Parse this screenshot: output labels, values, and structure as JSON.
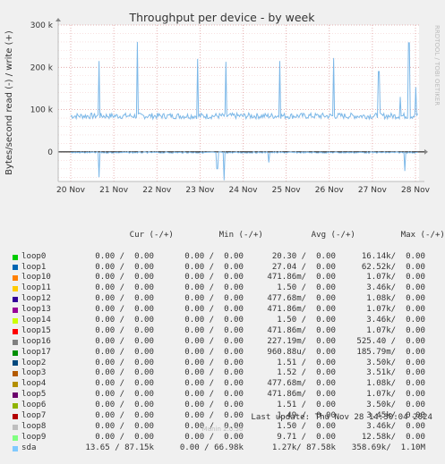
{
  "chart_data": {
    "type": "line",
    "title": "Throughput per device - by week",
    "ylabel": "Bytes/second read (-) / write (+)",
    "ylim": [
      -70000,
      300000
    ],
    "yticks": [
      {
        "value": 300000,
        "label": "300 k"
      },
      {
        "value": 200000,
        "label": "200 k"
      },
      {
        "value": 100000,
        "label": "100 k"
      },
      {
        "value": 0,
        "label": "0"
      }
    ],
    "xticks": [
      "20 Nov",
      "21 Nov",
      "22 Nov",
      "23 Nov",
      "24 Nov",
      "25 Nov",
      "26 Nov",
      "27 Nov",
      "28 Nov"
    ],
    "grid": true,
    "series": [
      {
        "name": "sda",
        "color": "#7cb8e8",
        "write_approx": {
          "baseline": 85000,
          "spikes": [
            {
              "day": 0.65,
              "value": 215000
            },
            {
              "day": 1.55,
              "value": 260000
            },
            {
              "day": 2.95,
              "value": 220000
            },
            {
              "day": 3.6,
              "value": 213000
            },
            {
              "day": 4.85,
              "value": 215000
            },
            {
              "day": 6.1,
              "value": 222000
            },
            {
              "day": 7.15,
              "value": 190000
            },
            {
              "day": 7.65,
              "value": 130000
            },
            {
              "day": 7.85,
              "value": 258000
            },
            {
              "day": 8.0,
              "value": 153000
            }
          ]
        },
        "read_approx": {
          "baseline": 0,
          "spikes": [
            {
              "day": 0.65,
              "value": -60000
            },
            {
              "day": 3.4,
              "value": -40000
            },
            {
              "day": 3.55,
              "value": -66980
            },
            {
              "day": 4.6,
              "value": -25000
            },
            {
              "day": 7.75,
              "value": -45000
            }
          ]
        }
      }
    ]
  },
  "legend": {
    "headers": {
      "cur": "Cur (-/+)",
      "min": "Min (-/+)",
      "avg": "Avg (-/+)",
      "max": "Max (-/+)"
    },
    "rows": [
      {
        "name": "loop0",
        "color": "#00cc00",
        "cur": "0.00 /  0.00",
        "min": "0.00 /  0.00",
        "avg": "20.30 /  0.00",
        "max": "16.14k/  0.00"
      },
      {
        "name": "loop1",
        "color": "#0066b3",
        "cur": "0.00 /  0.00",
        "min": "0.00 /  0.00",
        "avg": "27.04 /  0.00",
        "max": "62.52k/  0.00"
      },
      {
        "name": "loop10",
        "color": "#ff8000",
        "cur": "0.00 /  0.00",
        "min": "0.00 /  0.00",
        "avg": "471.86m/  0.00",
        "max": "1.07k/  0.00"
      },
      {
        "name": "loop11",
        "color": "#ffcc00",
        "cur": "0.00 /  0.00",
        "min": "0.00 /  0.00",
        "avg": "1.50 /  0.00",
        "max": "3.46k/  0.00"
      },
      {
        "name": "loop12",
        "color": "#330099",
        "cur": "0.00 /  0.00",
        "min": "0.00 /  0.00",
        "avg": "477.68m/  0.00",
        "max": "1.08k/  0.00"
      },
      {
        "name": "loop13",
        "color": "#990099",
        "cur": "0.00 /  0.00",
        "min": "0.00 /  0.00",
        "avg": "471.86m/  0.00",
        "max": "1.07k/  0.00"
      },
      {
        "name": "loop14",
        "color": "#ccff00",
        "cur": "0.00 /  0.00",
        "min": "0.00 /  0.00",
        "avg": "1.50 /  0.00",
        "max": "3.46k/  0.00"
      },
      {
        "name": "loop15",
        "color": "#ff0000",
        "cur": "0.00 /  0.00",
        "min": "0.00 /  0.00",
        "avg": "471.86m/  0.00",
        "max": "1.07k/  0.00"
      },
      {
        "name": "loop16",
        "color": "#808080",
        "cur": "0.00 /  0.00",
        "min": "0.00 /  0.00",
        "avg": "227.19m/  0.00",
        "max": "525.40 /  0.00"
      },
      {
        "name": "loop17",
        "color": "#008f00",
        "cur": "0.00 /  0.00",
        "min": "0.00 /  0.00",
        "avg": "960.88u/  0.00",
        "max": "185.79m/  0.00"
      },
      {
        "name": "loop2",
        "color": "#00487d",
        "cur": "0.00 /  0.00",
        "min": "0.00 /  0.00",
        "avg": "1.51 /  0.00",
        "max": "3.50k/  0.00"
      },
      {
        "name": "loop3",
        "color": "#b35a00",
        "cur": "0.00 /  0.00",
        "min": "0.00 /  0.00",
        "avg": "1.52 /  0.00",
        "max": "3.51k/  0.00"
      },
      {
        "name": "loop4",
        "color": "#b38f00",
        "cur": "0.00 /  0.00",
        "min": "0.00 /  0.00",
        "avg": "477.68m/  0.00",
        "max": "1.08k/  0.00"
      },
      {
        "name": "loop5",
        "color": "#6b006b",
        "cur": "0.00 /  0.00",
        "min": "0.00 /  0.00",
        "avg": "471.86m/  0.00",
        "max": "1.07k/  0.00"
      },
      {
        "name": "loop6",
        "color": "#8fb300",
        "cur": "0.00 /  0.00",
        "min": "0.00 /  0.00",
        "avg": "1.51 /  0.00",
        "max": "3.50k/  0.00"
      },
      {
        "name": "loop7",
        "color": "#b30000",
        "cur": "0.00 /  0.00",
        "min": "0.00 /  0.00",
        "avg": "1.49 /  0.00",
        "max": "3.45k/  0.00"
      },
      {
        "name": "loop8",
        "color": "#bebebe",
        "cur": "0.00 /  0.00",
        "min": "0.00 /  0.00",
        "avg": "1.50 /  0.00",
        "max": "3.46k/  0.00"
      },
      {
        "name": "loop9",
        "color": "#80ff80",
        "cur": "0.00 /  0.00",
        "min": "0.00 /  0.00",
        "avg": "9.71 /  0.00",
        "max": "12.58k/  0.00"
      },
      {
        "name": "sda",
        "color": "#80c9ff",
        "cur": "13.65 / 87.15k",
        "min": "0.00 / 66.98k",
        "avg": "1.27k/ 87.58k",
        "max": "358.69k/  1.10M"
      }
    ]
  },
  "last_update": "Last update: Thu Nov 28 14:30:04 2024",
  "side_label": "RRDTOOL / TOBI OETIKER",
  "munin_version": "Munin 2.0.56"
}
